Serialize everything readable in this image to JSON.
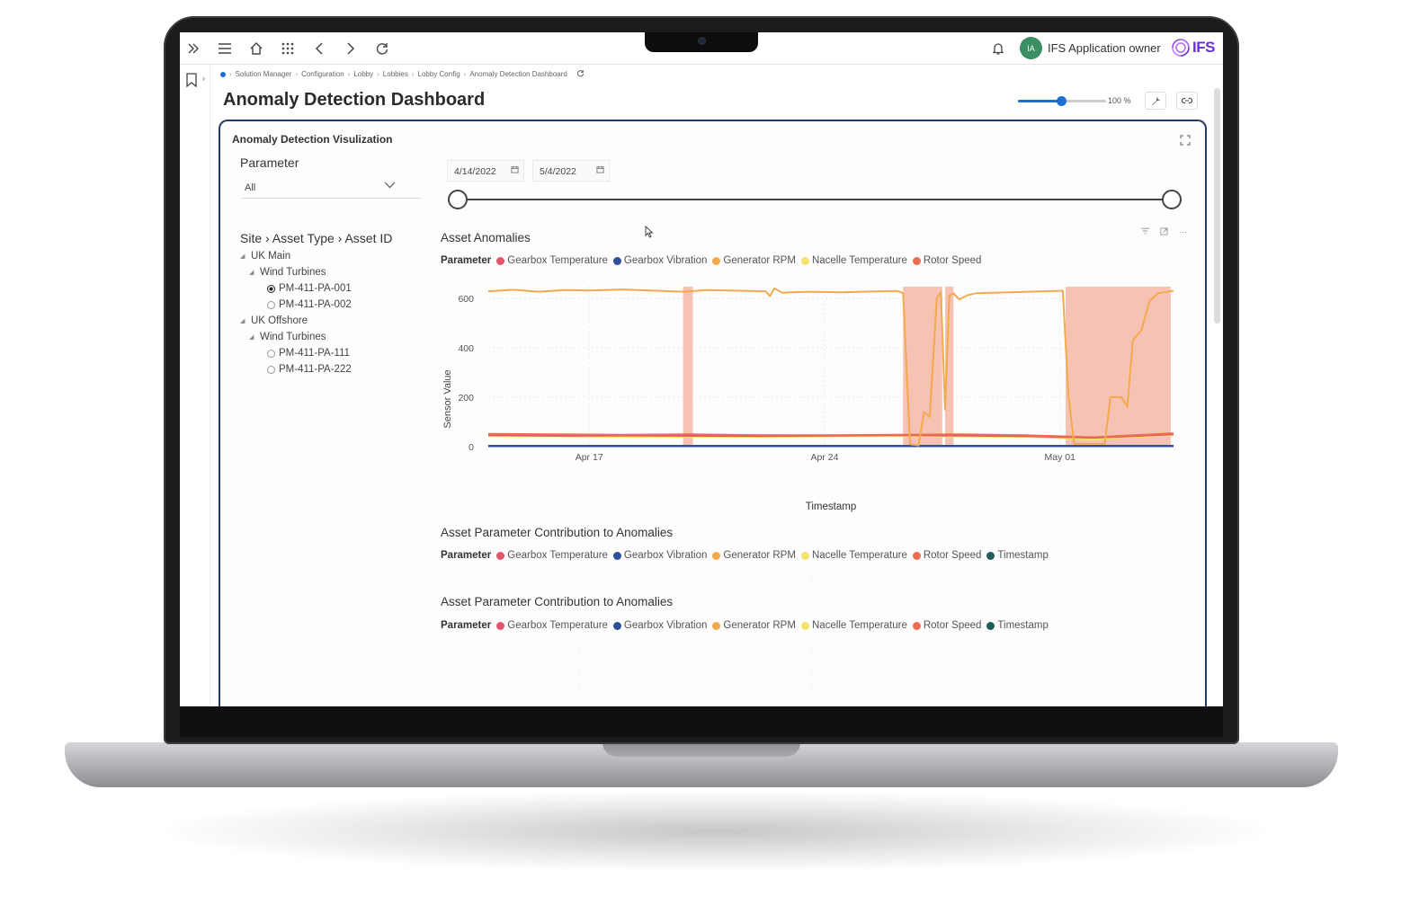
{
  "topbar": {
    "user_initials": "IA",
    "user_name": "IFS Application owner",
    "logo_text": "IFS"
  },
  "breadcrumb": [
    "Solution Manager",
    "Configuration",
    "Lobby",
    "Lobbies",
    "Lobby Config",
    "Anomaly Detection Dashboard"
  ],
  "page": {
    "title": "Anomaly Detection Dashboard",
    "zoom_label": "100 %",
    "zoom_value": 0.49
  },
  "card": {
    "title": "Anomaly Detection Visulization"
  },
  "filters": {
    "parameter_label": "Parameter",
    "parameter_value": "All",
    "hierarchy_label": "Site › Asset Type › Asset ID",
    "tree": [
      {
        "label": "UK Main",
        "level": 0,
        "type": "node"
      },
      {
        "label": "Wind Turbines",
        "level": 1,
        "type": "node"
      },
      {
        "label": "PM-411-PA-001",
        "level": 2,
        "type": "radio",
        "selected": true
      },
      {
        "label": "PM-411-PA-002",
        "level": 2,
        "type": "radio",
        "selected": false
      },
      {
        "label": "UK Offshore",
        "level": 0,
        "type": "node"
      },
      {
        "label": "Wind Turbines",
        "level": 1,
        "type": "node"
      },
      {
        "label": "PM-411-PA-111",
        "level": 2,
        "type": "radio",
        "selected": false
      },
      {
        "label": "PM-411-PA-222",
        "level": 2,
        "type": "radio",
        "selected": false
      }
    ],
    "date_start": "4/14/2022",
    "date_end": "5/4/2022"
  },
  "legend_title": "Parameter",
  "colors": {
    "gearbox_temperature": "#e2566a",
    "gearbox_vibration": "#2f4f9b",
    "generator_rpm": "#f3aa4e",
    "nacelle_temperature": "#f5e36a",
    "rotor_speed": "#ec6d52",
    "timestamp": "#1f5d5a",
    "anomaly_band": "#f4b7a6",
    "accent": "#1f6fd1",
    "card_border": "#243b6b"
  },
  "sections": [
    {
      "title": "Asset Anomalies",
      "legend": [
        "Gearbox Temperature",
        "Gearbox Vibration",
        "Generator RPM",
        "Nacelle Temperature",
        "Rotor Speed"
      ]
    },
    {
      "title": "Asset Parameter Contribution to Anomalies",
      "legend": [
        "Gearbox Temperature",
        "Gearbox Vibration",
        "Generator RPM",
        "Nacelle Temperature",
        "Rotor Speed",
        "Timestamp"
      ]
    },
    {
      "title": "Asset Parameter Contribution to Anomalies",
      "legend": [
        "Gearbox Temperature",
        "Gearbox Vibration",
        "Generator RPM",
        "Nacelle Temperature",
        "Rotor Speed",
        "Timestamp"
      ]
    }
  ],
  "chart_data": {
    "type": "line",
    "ylabel": "Sensor Value",
    "xlabel": "Timestamp",
    "ylim": [
      0,
      650
    ],
    "y_ticks": [
      0,
      200,
      400,
      600
    ],
    "x_range": [
      "2022-04-14",
      "2022-05-04"
    ],
    "x_ticks": [
      {
        "date": "2022-04-17",
        "label": "Apr 17"
      },
      {
        "date": "2022-04-24",
        "label": "Apr 24"
      },
      {
        "date": "2022-05-01",
        "label": "May 01"
      }
    ],
    "anomaly_ranges": [
      [
        "2022-04-19 19:00",
        "2022-04-20 02:00"
      ],
      [
        "2022-04-26 08:00",
        "2022-04-27 12:00"
      ],
      [
        "2022-04-27 14:00",
        "2022-04-27 20:00"
      ],
      [
        "2022-05-01 04:00",
        "2022-05-04 07:00"
      ]
    ],
    "series": [
      {
        "name": "Generator RPM",
        "points": [
          [
            "2022-04-14 00:00",
            628
          ],
          [
            "2022-04-14 18:00",
            634
          ],
          [
            "2022-04-15 12:00",
            626
          ],
          [
            "2022-04-16 06:00",
            633
          ],
          [
            "2022-04-17 00:00",
            631
          ],
          [
            "2022-04-18 00:00",
            635
          ],
          [
            "2022-04-19 00:00",
            630
          ],
          [
            "2022-04-19 20:00",
            626
          ],
          [
            "2022-04-20 12:00",
            633
          ],
          [
            "2022-04-21 12:00",
            630
          ],
          [
            "2022-04-22 06:00",
            628
          ],
          [
            "2022-04-22 09:00",
            608
          ],
          [
            "2022-04-22 12:00",
            640
          ],
          [
            "2022-04-22 18:00",
            622
          ],
          [
            "2022-04-23 12:00",
            626
          ],
          [
            "2022-04-24 12:00",
            624
          ],
          [
            "2022-04-25 12:00",
            627
          ],
          [
            "2022-04-26 04:00",
            629
          ],
          [
            "2022-04-26 08:00",
            620
          ],
          [
            "2022-04-26 13:00",
            10
          ],
          [
            "2022-04-26 19:00",
            5
          ],
          [
            "2022-04-26 23:00",
            140
          ],
          [
            "2022-04-27 03:00",
            120
          ],
          [
            "2022-04-27 08:00",
            600
          ],
          [
            "2022-04-27 11:00",
            625
          ],
          [
            "2022-04-27 14:00",
            150
          ],
          [
            "2022-04-27 17:00",
            610
          ],
          [
            "2022-04-27 20:00",
            620
          ],
          [
            "2022-04-28 00:00",
            595
          ],
          [
            "2022-04-28 06:00",
            612
          ],
          [
            "2022-04-28 12:00",
            620
          ],
          [
            "2022-04-29 12:00",
            624
          ],
          [
            "2022-04-30 12:00",
            628
          ],
          [
            "2022-05-01 02:00",
            630
          ],
          [
            "2022-05-01 06:00",
            210
          ],
          [
            "2022-05-01 10:00",
            12
          ],
          [
            "2022-05-02 00:00",
            12
          ],
          [
            "2022-05-02 08:00",
            12
          ],
          [
            "2022-05-02 12:00",
            200
          ],
          [
            "2022-05-02 20:00",
            200
          ],
          [
            "2022-05-03 00:00",
            160
          ],
          [
            "2022-05-03 04:00",
            430
          ],
          [
            "2022-05-03 10:00",
            470
          ],
          [
            "2022-05-03 16:00",
            590
          ],
          [
            "2022-05-03 22:00",
            620
          ],
          [
            "2022-05-04 09:00",
            630
          ]
        ]
      },
      {
        "name": "Rotor Speed",
        "points": [
          [
            "2022-04-14 00:00",
            52
          ],
          [
            "2022-04-16 00:00",
            50
          ],
          [
            "2022-04-18 00:00",
            48
          ],
          [
            "2022-04-20 00:00",
            50
          ],
          [
            "2022-04-22 00:00",
            47
          ],
          [
            "2022-04-24 00:00",
            46
          ],
          [
            "2022-04-26 00:00",
            48
          ],
          [
            "2022-04-28 00:00",
            50
          ],
          [
            "2022-04-30 00:00",
            46
          ],
          [
            "2022-05-02 00:00",
            38
          ],
          [
            "2022-05-04 09:00",
            54
          ]
        ]
      },
      {
        "name": "Gearbox Temperature",
        "points": [
          [
            "2022-04-14 00:00",
            46
          ],
          [
            "2022-04-16 00:00",
            44
          ],
          [
            "2022-04-18 00:00",
            45
          ],
          [
            "2022-04-20 00:00",
            44
          ],
          [
            "2022-04-22 00:00",
            43
          ],
          [
            "2022-04-24 00:00",
            44
          ],
          [
            "2022-04-26 00:00",
            46
          ],
          [
            "2022-04-28 00:00",
            45
          ],
          [
            "2022-04-30 00:00",
            42
          ],
          [
            "2022-05-02 00:00",
            36
          ],
          [
            "2022-05-04 09:00",
            50
          ]
        ]
      },
      {
        "name": "Nacelle Temperature",
        "points": [
          [
            "2022-04-14 00:00",
            42
          ],
          [
            "2022-04-18 00:00",
            40
          ],
          [
            "2022-04-22 00:00",
            40
          ],
          [
            "2022-04-26 00:00",
            42
          ],
          [
            "2022-04-30 00:00",
            40
          ],
          [
            "2022-05-02 00:00",
            30
          ],
          [
            "2022-05-04 09:00",
            46
          ]
        ]
      },
      {
        "name": "Gearbox Vibration",
        "points": [
          [
            "2022-04-14 00:00",
            3
          ],
          [
            "2022-04-24 00:00",
            3
          ],
          [
            "2022-05-04 09:00",
            3
          ]
        ]
      }
    ]
  }
}
